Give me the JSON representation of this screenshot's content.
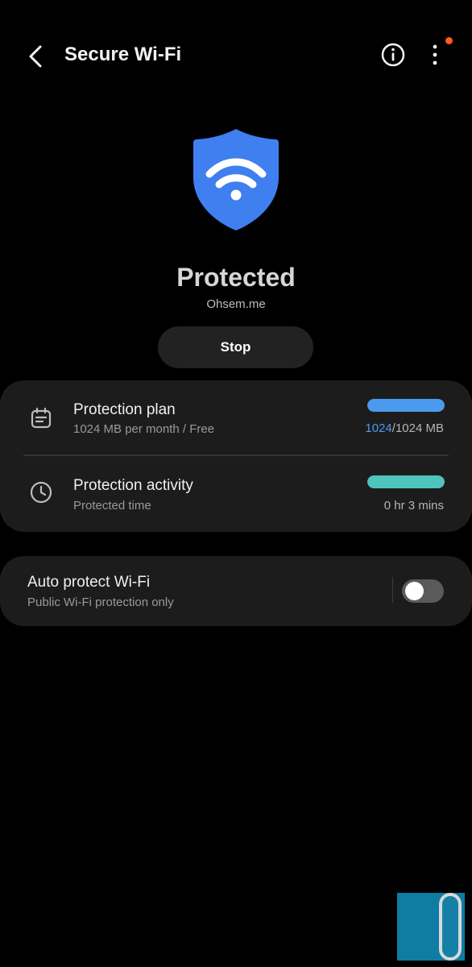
{
  "header": {
    "title": "Secure Wi-Fi",
    "back_icon": "chevron-left-icon",
    "info_icon": "info-icon",
    "more_icon": "more-vertical-icon",
    "notification_dot_color": "#ff5a1f"
  },
  "hero": {
    "icon": "wifi-shield-icon",
    "shield_color": "#3f7ff0",
    "status": "Protected",
    "provider": "Ohsem.me",
    "stop_label": "Stop"
  },
  "plan": {
    "icon": "calendar-icon",
    "title": "Protection plan",
    "subtitle": "1024 MB per month / Free",
    "used": "1024",
    "total": "/1024 MB",
    "progress": 1.0,
    "bar_color": "#4a9bf0"
  },
  "activity": {
    "icon": "clock-icon",
    "title": "Protection activity",
    "subtitle": "Protected time",
    "value": "0 hr 3 mins",
    "progress": 1.0,
    "bar_color": "#4fc3be"
  },
  "auto_protect": {
    "title": "Auto protect Wi-Fi",
    "subtitle": "Public Wi-Fi protection only",
    "enabled": false
  },
  "overlay": {
    "icon": "floating-handle-icon",
    "color": "#0f7ca3"
  }
}
